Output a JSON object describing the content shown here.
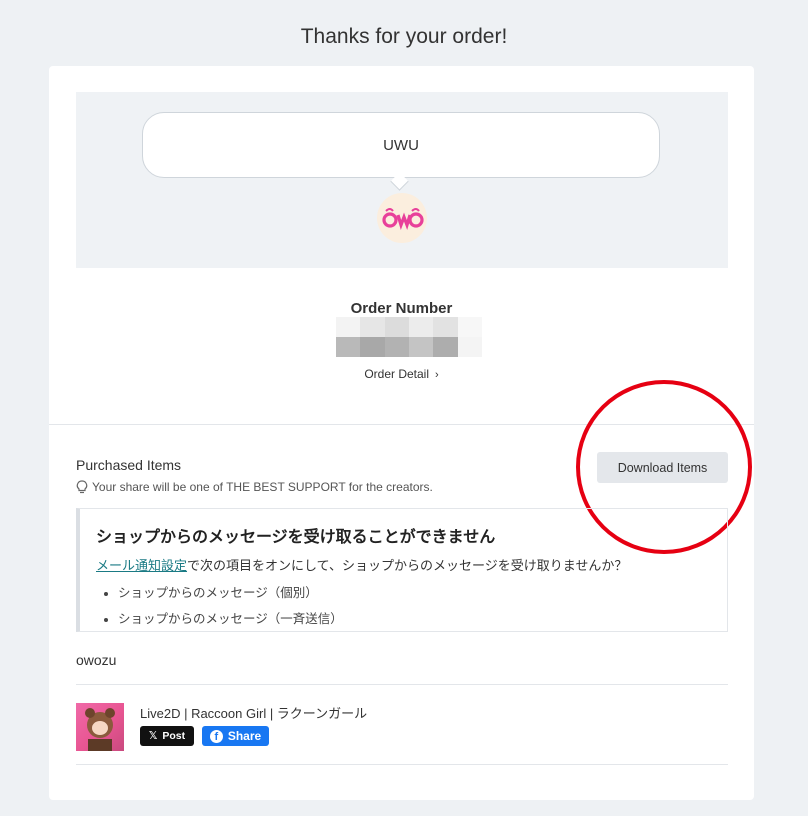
{
  "page": {
    "title": "Thanks for your order!"
  },
  "message": {
    "text": "UWU",
    "shop_logo_icon": "owo-logo-icon"
  },
  "order": {
    "number_label": "Order Number",
    "detail_link": "Order Detail",
    "chevron_icon": "chevron-right-icon"
  },
  "purchased": {
    "title": "Purchased Items",
    "support_icon": "lightbulb-icon",
    "support_note": "Your share will be one of THE BEST SUPPORT for the creators.",
    "download_label": "Download Items"
  },
  "notice": {
    "title": "ショップからのメッセージを受け取ることができません",
    "link_text": "メール通知設定",
    "body_text": "で次の項目をオンにして、ショップからのメッセージを受け取りませんか？",
    "items": [
      "ショップからのメッセージ（個別）",
      "ショップからのメッセージ（一斉送信）"
    ]
  },
  "shop": {
    "name": "owozu"
  },
  "item": {
    "title": "Live2D | Raccoon Girl | ラクーンガール",
    "x_post_label": "Post",
    "fb_share_label": "Share"
  },
  "colors": {
    "background": "#eef1f4",
    "annotation_circle": "#e60012",
    "link": "#1a7a84",
    "facebook": "#1877f2",
    "x": "#111111"
  }
}
